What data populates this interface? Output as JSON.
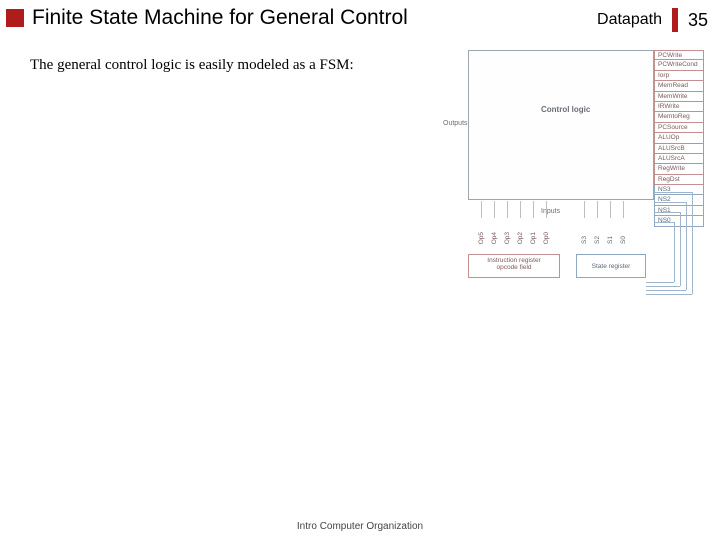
{
  "header": {
    "title": "Finite State Machine for General Control",
    "right_label": "Datapath",
    "page_number": "35"
  },
  "body": {
    "paragraph": "The general control logic is easily modeled as a FSM:"
  },
  "diagram": {
    "control_logic_label": "Control logic",
    "outputs_label": "Outputs",
    "inputs_label": "Inputs",
    "signals_out": [
      "PCWrite",
      "PCWriteCond",
      "Iorp",
      "MemRead",
      "MemWrite",
      "IRWrite",
      "MemtoReg",
      "PCSource",
      "ALUOp",
      "ALUSrcB",
      "ALUSrcA",
      "RegWrite",
      "RegDst"
    ],
    "signals_ns": [
      "NS3",
      "NS2",
      "NS1",
      "NS0"
    ],
    "inputs_op": [
      "Op5",
      "Op4",
      "Op3",
      "Op2",
      "Op1",
      "Op0"
    ],
    "inputs_s": [
      "S3",
      "S2",
      "S1",
      "S0"
    ],
    "ir_box_line1": "Instruction register",
    "ir_box_line2": "opcode field",
    "sr_box": "State register"
  },
  "footer": {
    "text": "Intro Computer Organization"
  }
}
